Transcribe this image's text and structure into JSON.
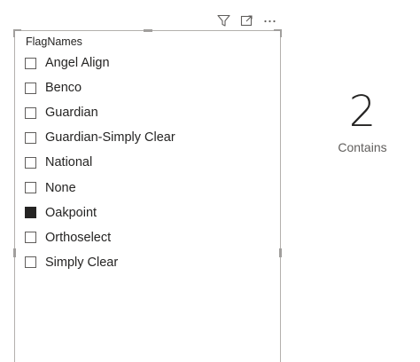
{
  "toolbar": {
    "icons": [
      "filter-icon",
      "focus-mode-icon",
      "more-options-icon"
    ]
  },
  "slicer": {
    "header": "FlagNames",
    "items": [
      {
        "label": "Angel Align",
        "checked": false
      },
      {
        "label": "Benco",
        "checked": false
      },
      {
        "label": "Guardian",
        "checked": false
      },
      {
        "label": "Guardian-Simply Clear",
        "checked": false
      },
      {
        "label": "National",
        "checked": false
      },
      {
        "label": "None",
        "checked": false
      },
      {
        "label": "Oakpoint",
        "checked": true
      },
      {
        "label": "Orthoselect",
        "checked": false
      },
      {
        "label": "Simply Clear",
        "checked": false
      }
    ]
  },
  "card": {
    "value": "2",
    "label": "Contains"
  }
}
